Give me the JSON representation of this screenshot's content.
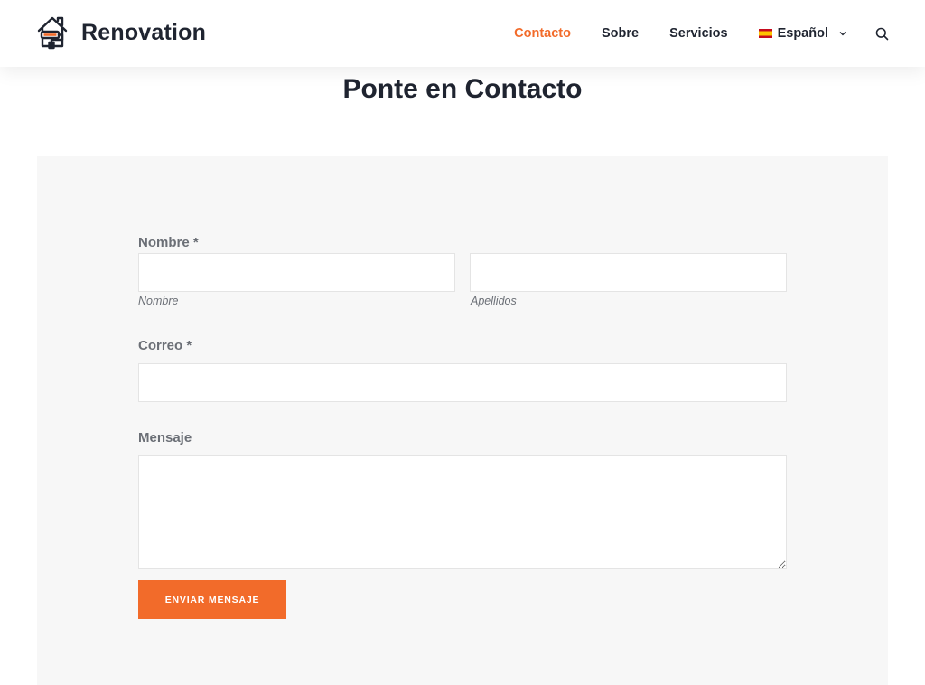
{
  "brand": {
    "name": "Renovation",
    "accent": "#f26b2a"
  },
  "nav": {
    "items": [
      {
        "label": "Contacto",
        "active": true
      },
      {
        "label": "Sobre",
        "active": false
      },
      {
        "label": "Servicios",
        "active": false
      }
    ],
    "language": {
      "label": "Español",
      "flag_icon": "spain-flag-icon"
    }
  },
  "page": {
    "title": "Ponte en Contacto"
  },
  "form": {
    "name": {
      "label": "Nombre *",
      "first_sublabel": "Nombre",
      "last_sublabel": "Apellidos",
      "first_value": "",
      "last_value": ""
    },
    "email": {
      "label": "Correo *",
      "value": ""
    },
    "message": {
      "label": "Mensaje",
      "value": ""
    },
    "submit_label": "ENVIAR MENSAJE"
  }
}
